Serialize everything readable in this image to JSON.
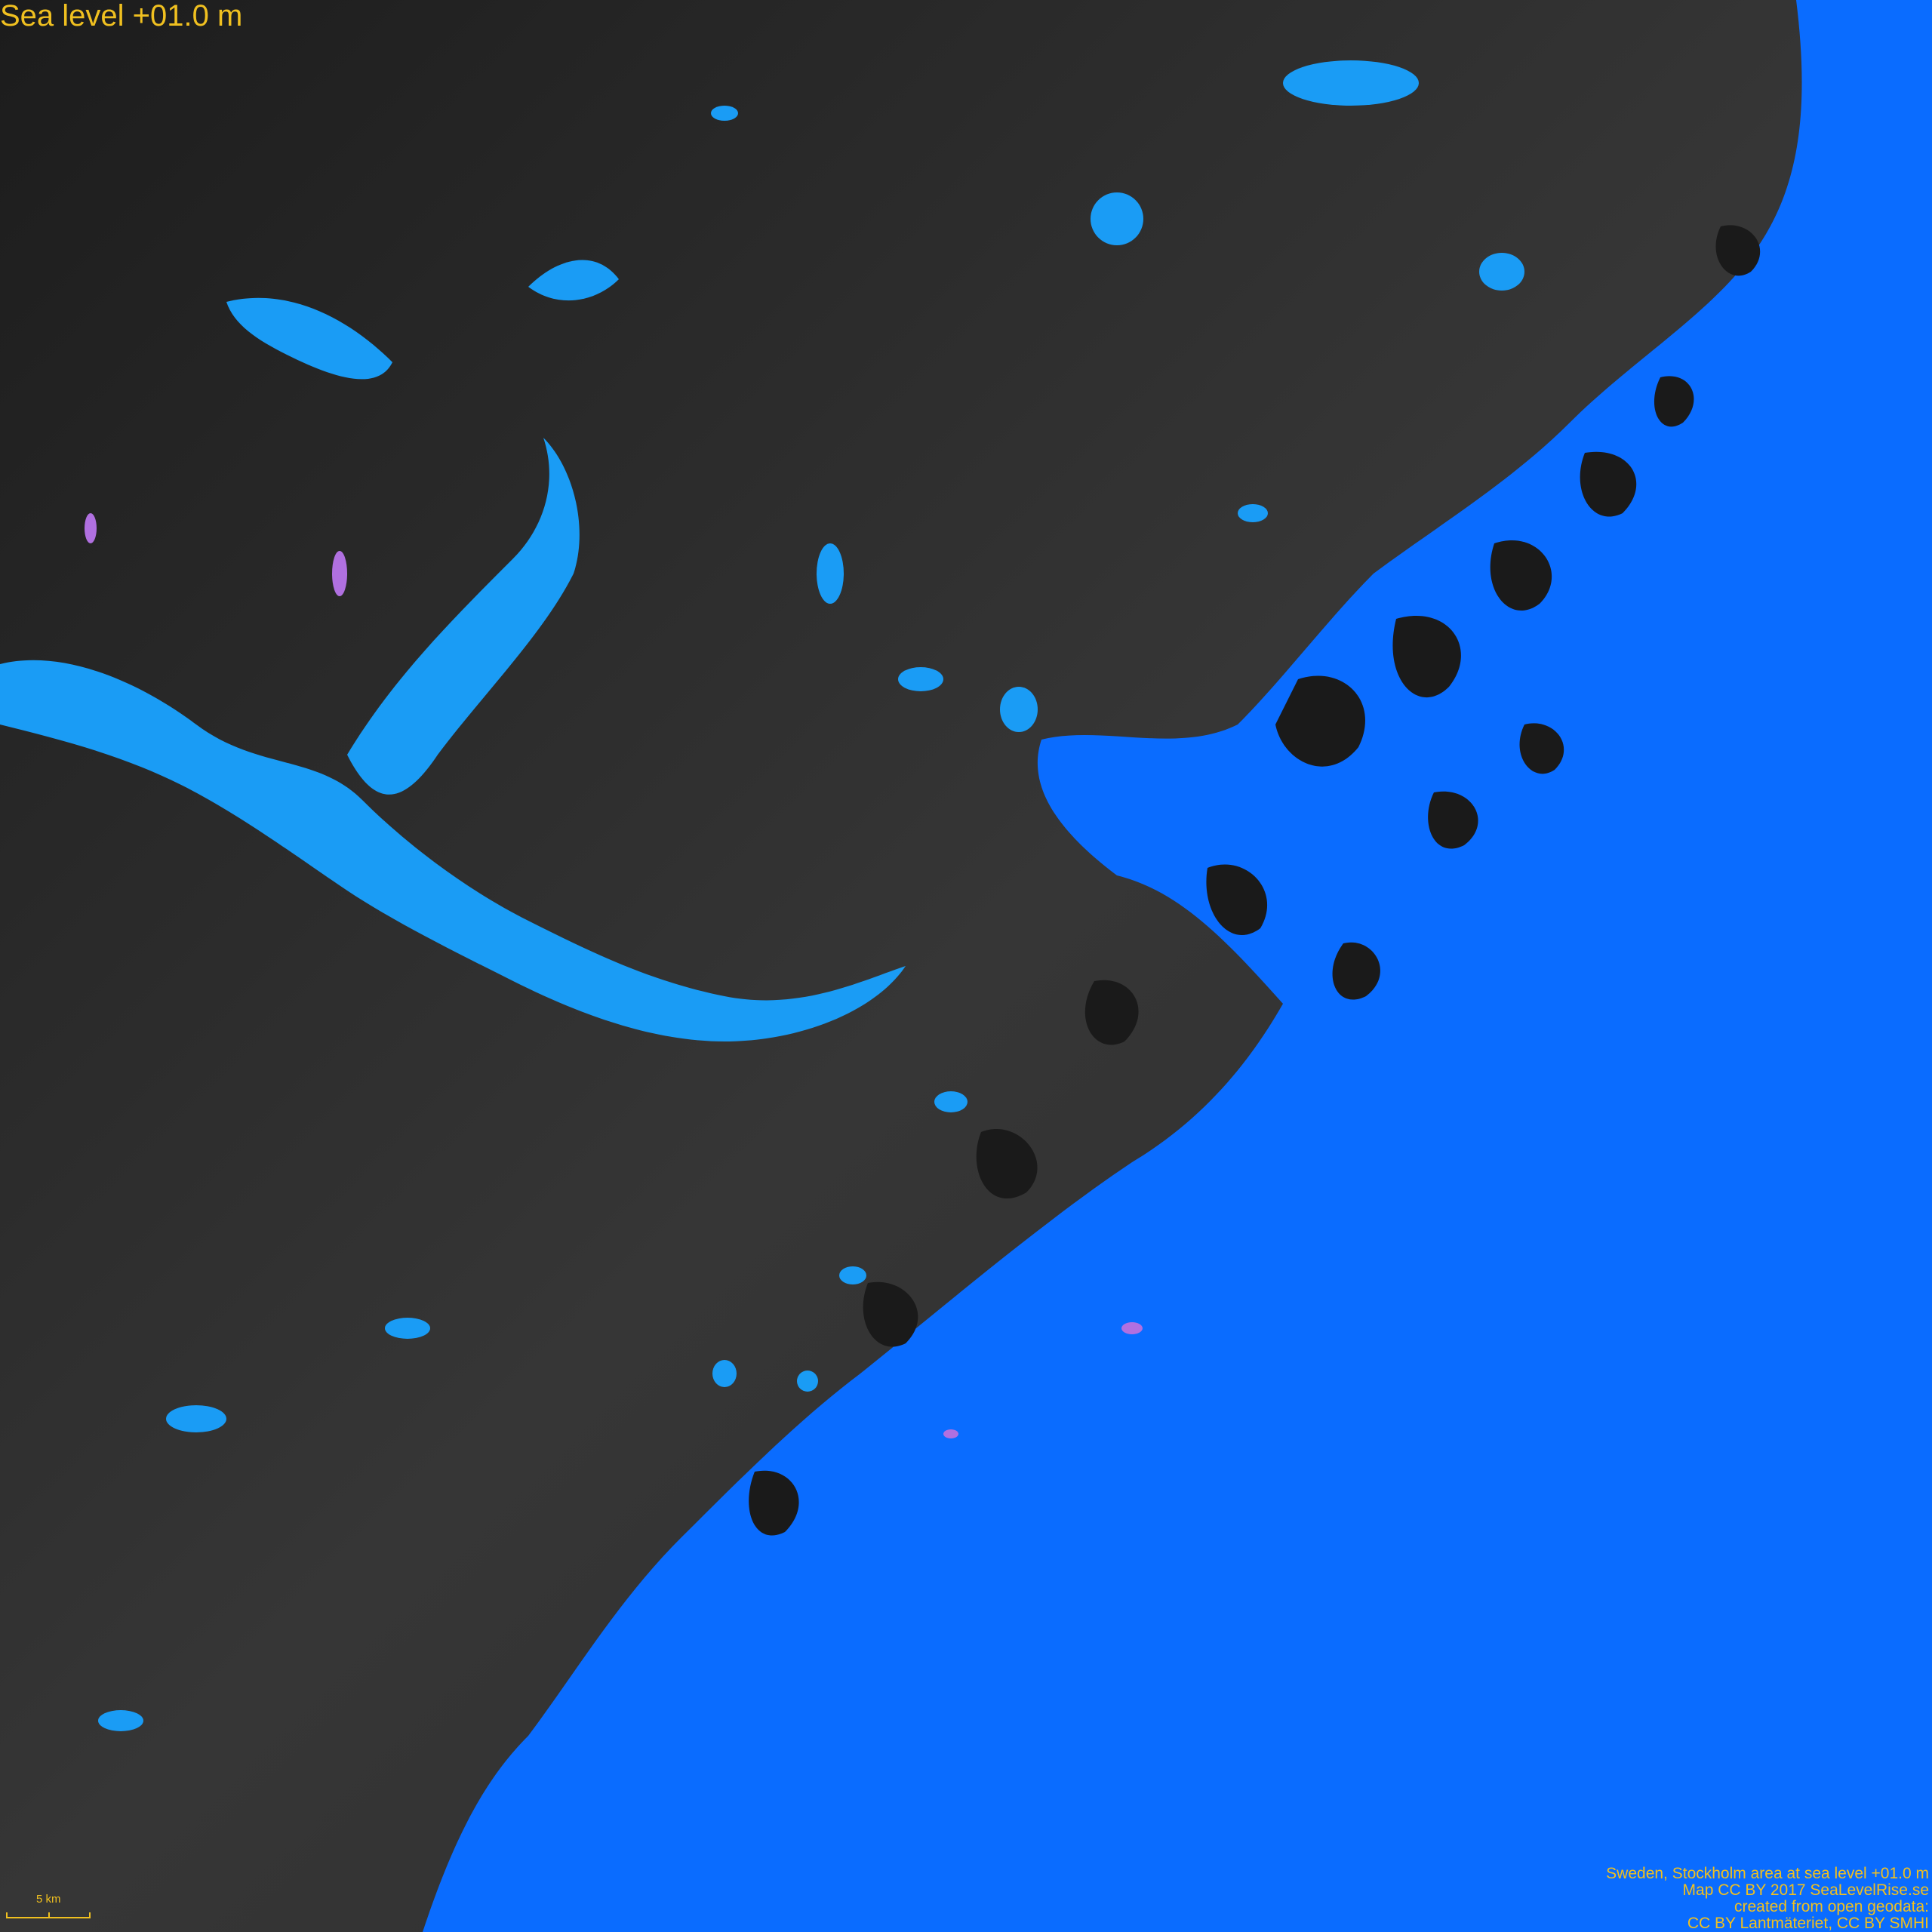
{
  "map": {
    "title": "Sea level +01.0 m",
    "credits": [
      "Sweden, Stockholm area at sea level +01.0 m",
      "Map CC BY 2017 SeaLevelRise.se",
      "created from open geodata:",
      "CC BY Lantmäteriet, CC BY SMHI"
    ],
    "scale_bar": {
      "label": "5 km"
    },
    "colors": {
      "sea": "#0a6cff",
      "lakes": "#1a9cf5",
      "land": "#2a2a2a",
      "newly_flooded": "#b070e0",
      "text": "#f0c020"
    }
  }
}
